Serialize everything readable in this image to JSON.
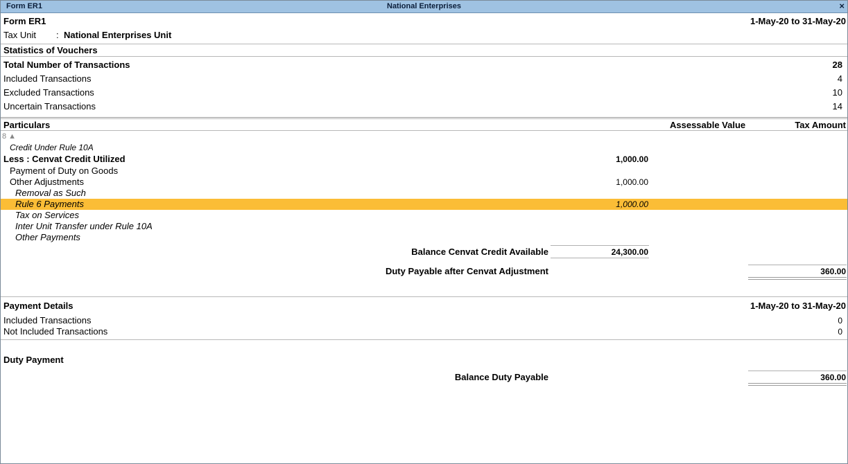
{
  "window": {
    "title_left": "Form ER1",
    "title_center": "National Enterprises",
    "close": "×"
  },
  "header": {
    "form_name": "Form ER1",
    "period": "1-May-20 to 31-May-20",
    "tax_unit_label": "Tax Unit",
    "tax_unit_sep": ":",
    "tax_unit_value": "National Enterprises Unit"
  },
  "stats": {
    "title": "Statistics of Vouchers",
    "total_label": "Total Number of Transactions",
    "total_value": "28",
    "included_label": "Included Transactions",
    "included_value": "4",
    "excluded_label": "Excluded Transactions",
    "excluded_value": "10",
    "uncertain_label": "Uncertain Transactions",
    "uncertain_value": "14"
  },
  "columns": {
    "particulars": "Particulars",
    "assessable": "Assessable Value",
    "tax_amount": "Tax Amount"
  },
  "scroll_indicator": "8 ▲",
  "rows": {
    "credit_rule10a": "Credit Under Rule 10A",
    "less_cenvat_label": "Less : Cenvat Credit Utilized",
    "less_cenvat_value": "1,000.00",
    "payment_duty_goods": "Payment of Duty on Goods",
    "other_adjustments_label": "Other Adjustments",
    "other_adjustments_value": "1,000.00",
    "removal_as_such": "Removal as Such",
    "rule6_label": "Rule 6 Payments",
    "rule6_value": "1,000.00",
    "tax_on_services": "Tax on Services",
    "inter_unit": "Inter Unit Transfer under Rule 10A",
    "other_payments": "Other Payments",
    "balance_cenvat_label": "Balance Cenvat Credit Available",
    "balance_cenvat_value": "24,300.00",
    "duty_payable_label": "Duty Payable after Cenvat Adjustment",
    "duty_payable_value": "360.00"
  },
  "payment_details": {
    "title": "Payment Details",
    "period": "1-May-20 to 31-May-20",
    "included_label": "Included Transactions",
    "included_value": "0",
    "not_included_label": "Not Included Transactions",
    "not_included_value": "0"
  },
  "duty_payment": {
    "title": "Duty Payment",
    "balance_label": "Balance Duty Payable",
    "balance_value": "360.00"
  }
}
